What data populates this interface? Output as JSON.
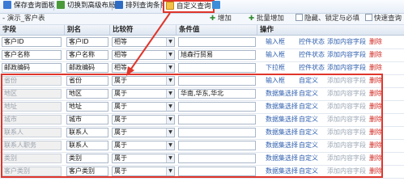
{
  "toolbar": {
    "items": [
      {
        "label": "保存查询面板",
        "icon": "save-icon",
        "color": "#3b7bd4"
      },
      {
        "label": "切换到高级布局",
        "icon": "layout-switch-icon",
        "color": "#4a9a3a"
      },
      {
        "label": "排列查询条件",
        "icon": "sort-icon",
        "color": "#2e6cc4"
      },
      {
        "label": "自定义查询",
        "icon": "custom-query-icon",
        "color": "#e0352b"
      },
      {
        "label": "",
        "icon": "export-icon",
        "color": "#3c8cd8"
      }
    ]
  },
  "panel": {
    "title": "- 演示_客户表",
    "tools": {
      "add": "增加",
      "batch_add": "批量增加",
      "hide_lock": "隐藏、锁定与必填",
      "fast_query": "快速查询"
    }
  },
  "table": {
    "headers": [
      "字段",
      "别名",
      "比较符",
      "条件值",
      "操作"
    ],
    "rows": [
      {
        "field": "客户ID",
        "alias": "客户ID",
        "op": "相等",
        "value": "",
        "disabled": false,
        "ops": [
          "输入框",
          "控件状态",
          "添加内容字段",
          "删除"
        ],
        "op_styles": [
          "blue",
          "blue",
          "blue",
          "red"
        ]
      },
      {
        "field": "客户名称",
        "alias": "客户名称",
        "op": "相等",
        "value": "旭森行贸易",
        "disabled": false,
        "ops": [
          "输入框",
          "控件状态",
          "添加内容字段",
          "删除"
        ],
        "op_styles": [
          "blue",
          "blue",
          "blue",
          "red"
        ]
      },
      {
        "field": "邮政编码",
        "alias": "邮政编码",
        "op": "相等",
        "value": "",
        "disabled": false,
        "ops": [
          "下拉框",
          "控件状态",
          "添加内容字段",
          "删除"
        ],
        "op_styles": [
          "blue",
          "blue",
          "blue",
          "red"
        ]
      },
      {
        "field": "省份",
        "alias": "省份",
        "op": "属于",
        "value": "",
        "disabled": true,
        "ops": [
          "输入框",
          "自定义",
          "添加内容字段",
          "删除"
        ],
        "op_styles": [
          "blue",
          "blue",
          "gray",
          "red"
        ]
      },
      {
        "field": "地区",
        "alias": "地区",
        "op": "属于",
        "value": "华南,华东,华北",
        "disabled": true,
        "ops": [
          "数据集选择",
          "自定义",
          "添加内容字段",
          "删除"
        ],
        "op_styles": [
          "blue",
          "blue",
          "gray",
          "red"
        ]
      },
      {
        "field": "地址",
        "alias": "地址",
        "op": "属于",
        "value": "",
        "disabled": true,
        "ops": [
          "数据集选择",
          "自定义",
          "添加内容字段",
          "删除"
        ],
        "op_styles": [
          "blue",
          "blue",
          "gray",
          "red"
        ]
      },
      {
        "field": "城市",
        "alias": "城市",
        "op": "属于",
        "value": "",
        "disabled": true,
        "ops": [
          "数据集选择",
          "自定义",
          "添加内容字段",
          "删除"
        ],
        "op_styles": [
          "blue",
          "blue",
          "gray",
          "red"
        ]
      },
      {
        "field": "联系人",
        "alias": "联系人",
        "op": "属于",
        "value": "",
        "disabled": true,
        "ops": [
          "数据集选择",
          "自定义",
          "添加内容字段",
          "删除"
        ],
        "op_styles": [
          "blue",
          "blue",
          "gray",
          "red"
        ]
      },
      {
        "field": "联系人职务",
        "alias": "联系人",
        "op": "属于",
        "value": "",
        "disabled": true,
        "ops": [
          "数据集选择",
          "自定义",
          "添加内容字段",
          "删除"
        ],
        "op_styles": [
          "blue",
          "blue",
          "gray",
          "red"
        ]
      },
      {
        "field": "类别",
        "alias": "类别",
        "op": "属于",
        "value": "",
        "disabled": true,
        "ops": [
          "数据集选择",
          "自定义",
          "添加内容字段",
          "删除"
        ],
        "op_styles": [
          "blue",
          "blue",
          "gray",
          "red"
        ]
      },
      {
        "field": "客户类别",
        "alias": "客户类别",
        "op": "属于",
        "value": "",
        "disabled": true,
        "ops": [
          "数据集选择",
          "自定义",
          "添加内容字段",
          "删除"
        ],
        "op_styles": [
          "blue",
          "blue",
          "gray",
          "red"
        ]
      }
    ]
  },
  "accent_color": "#e0352b"
}
